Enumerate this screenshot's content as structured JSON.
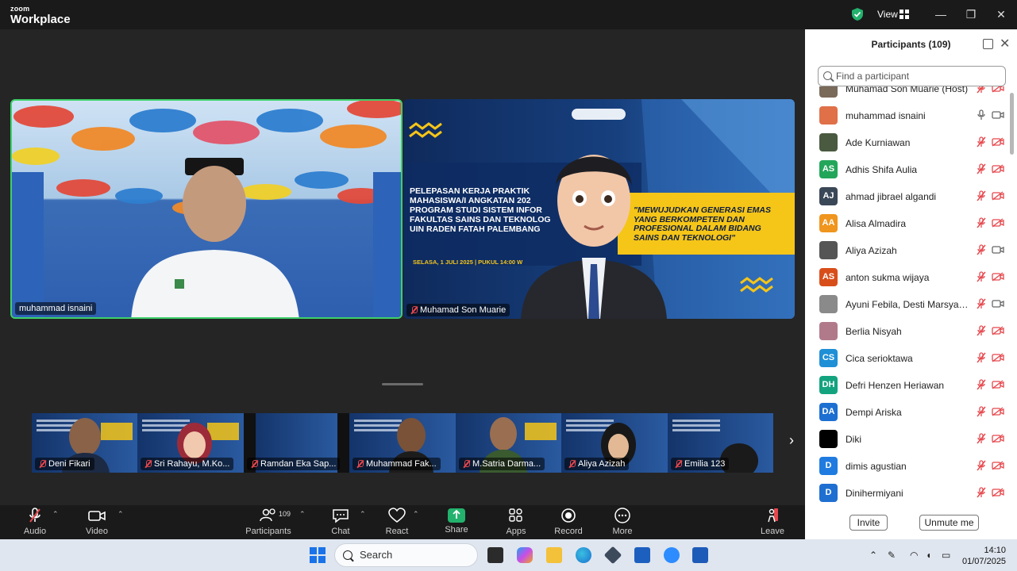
{
  "app": {
    "brand_top": "zoom",
    "brand_main": "Workplace",
    "view_label": "View"
  },
  "window_controls": {
    "minimize": "—",
    "maximize": "❐",
    "close": "✕"
  },
  "video": {
    "speaker_name": "muhammad isnaini",
    "slide_name": "Muhamad Son Muarie",
    "slide_title_lines": [
      "PELEPASAN KERJA PRAKTIK",
      "MAHASISWA/I ANGKATAN 202",
      "PROGRAM STUDI SISTEM INFOR",
      "FAKULTAS SAINS DAN TEKNOLOG",
      "UIN RADEN FATAH PALEMBANG"
    ],
    "slide_date": "SELASA, 1 JULI 2025 | PUKUL 14:00 W",
    "slide_quote_lines": [
      "\"MEWUJUDKAN GENERASI  EMAS",
      "YANG BERKOMPETEN DAN",
      "PROFESIONAL DALAM BIDANG",
      "SAINS DAN TEKNOLOGI\""
    ]
  },
  "thumbnails": [
    {
      "name": "Deni Fikari"
    },
    {
      "name": "Sri Rahayu, M.Ko..."
    },
    {
      "name": "Ramdan Eka Sap..."
    },
    {
      "name": "Muhammad Fak..."
    },
    {
      "name": "M.Satria Darma..."
    },
    {
      "name": "Aliya Azizah"
    },
    {
      "name": "Emilia 123"
    }
  ],
  "toolbar": {
    "audio": "Audio",
    "video": "Video",
    "participants": "Participants",
    "participants_count": "109",
    "chat": "Chat",
    "react": "React",
    "share": "Share",
    "apps": "Apps",
    "record": "Record",
    "more": "More",
    "leave": "Leave"
  },
  "panel": {
    "title": "Participants (109)",
    "search_placeholder": "Find a participant",
    "invite": "Invite",
    "unmute_me": "Unmute me",
    "participants": [
      {
        "name": "Muhamad Son Muarie (Host)",
        "initials": "",
        "color": "#7a6a5a",
        "mic": "off",
        "cam": "off"
      },
      {
        "name": "muhammad isnaini",
        "initials": "",
        "color": "#e07048",
        "mic": "on",
        "cam": "on"
      },
      {
        "name": "Ade Kurniawan",
        "initials": "",
        "color": "#4a5a40",
        "mic": "off",
        "cam": "off"
      },
      {
        "name": "Adhis Shifa Aulia",
        "initials": "AS",
        "color": "#23a65a",
        "mic": "off",
        "cam": "off"
      },
      {
        "name": "ahmad jibrael algandi",
        "initials": "AJ",
        "color": "#3a4756",
        "mic": "off",
        "cam": "off"
      },
      {
        "name": "Alisa Almadira",
        "initials": "AA",
        "color": "#f0951d",
        "mic": "off",
        "cam": "off"
      },
      {
        "name": "Aliya Azizah",
        "initials": "",
        "color": "#555555",
        "mic": "off",
        "cam": "on"
      },
      {
        "name": "anton sukma wijaya",
        "initials": "AS",
        "color": "#d84e1a",
        "mic": "off",
        "cam": "off"
      },
      {
        "name": "Ayuni Febila, Desti Marsyanda , ...",
        "initials": "",
        "color": "#8a8a8a",
        "mic": "off",
        "cam": "on"
      },
      {
        "name": "Berlia Nisyah",
        "initials": "",
        "color": "#b07a8a",
        "mic": "off",
        "cam": "off"
      },
      {
        "name": "Cica serioktawa",
        "initials": "CS",
        "color": "#1f8fd6",
        "mic": "off",
        "cam": "off"
      },
      {
        "name": "Defri Henzen Heriawan",
        "initials": "DH",
        "color": "#14a37f",
        "mic": "off",
        "cam": "off"
      },
      {
        "name": "Dempi Ariska",
        "initials": "DA",
        "color": "#1d6fd1",
        "mic": "off",
        "cam": "off"
      },
      {
        "name": "Diki",
        "initials": "",
        "color": "#000000",
        "mic": "off",
        "cam": "off"
      },
      {
        "name": "dimis agustian",
        "initials": "D",
        "color": "#1f7be0",
        "mic": "off",
        "cam": "off"
      },
      {
        "name": "Dinihermiyani",
        "initials": "D",
        "color": "#1f6fd1",
        "mic": "off",
        "cam": "off"
      }
    ]
  },
  "taskbar": {
    "search": "Search",
    "time": "14:10",
    "date": "01/07/2025"
  }
}
